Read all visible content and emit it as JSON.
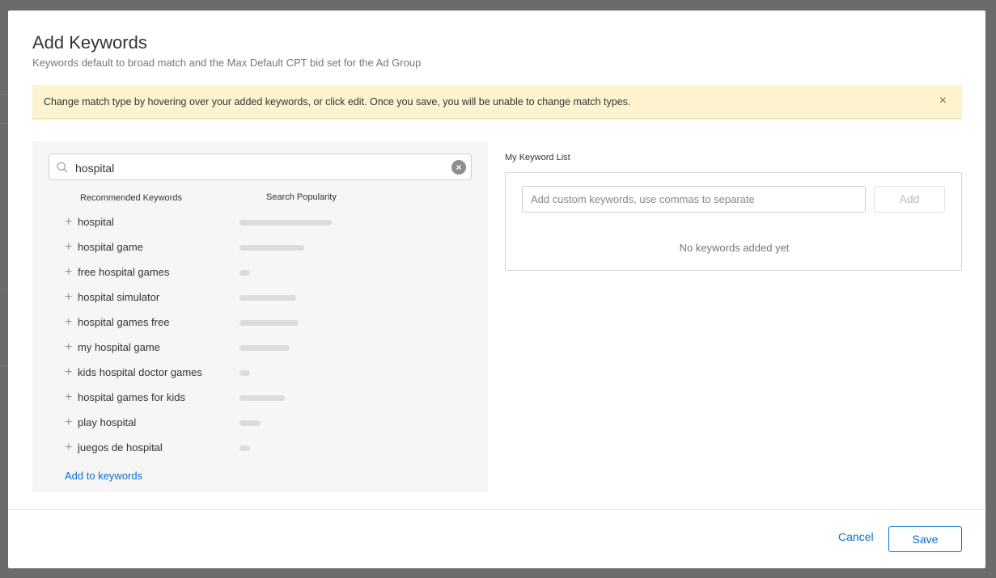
{
  "modal": {
    "title": "Add Keywords",
    "subtitle": "Keywords default to broad match and the Max Default CPT bid set for the Ad Group"
  },
  "banner": {
    "text": "Change match type by hovering over your added keywords, or click edit. Once you save, you will be unable to change match types.",
    "close_icon": "close-icon",
    "color": "#fdf4cf"
  },
  "search": {
    "value": "hospital",
    "icon": "search-icon",
    "clear_icon": "clear-icon"
  },
  "recommended": {
    "col_keyword": "Recommended Keywords",
    "col_popularity": "Search Popularity",
    "items": [
      {
        "label": "hospital",
        "popularity": 1.0
      },
      {
        "label": "hospital game",
        "popularity": 0.7
      },
      {
        "label": "free hospital games",
        "popularity": 0.11
      },
      {
        "label": "hospital simulator",
        "popularity": 0.61
      },
      {
        "label": "hospital games free",
        "popularity": 0.64
      },
      {
        "label": "my hospital game",
        "popularity": 0.54
      },
      {
        "label": "kids hospital doctor games",
        "popularity": 0.11
      },
      {
        "label": "hospital games for kids",
        "popularity": 0.49
      },
      {
        "label": "play hospital",
        "popularity": 0.23
      },
      {
        "label": "juegos de hospital",
        "popularity": 0.11
      }
    ],
    "add_link": "Add to keywords"
  },
  "keyword_list": {
    "label": "My Keyword List",
    "input_placeholder": "Add custom keywords, use commas to separate",
    "add_label": "Add",
    "empty_message": "No keywords added yet"
  },
  "footer": {
    "cancel_label": "Cancel",
    "save_label": "Save"
  },
  "colors": {
    "accent": "#0a6fce"
  }
}
